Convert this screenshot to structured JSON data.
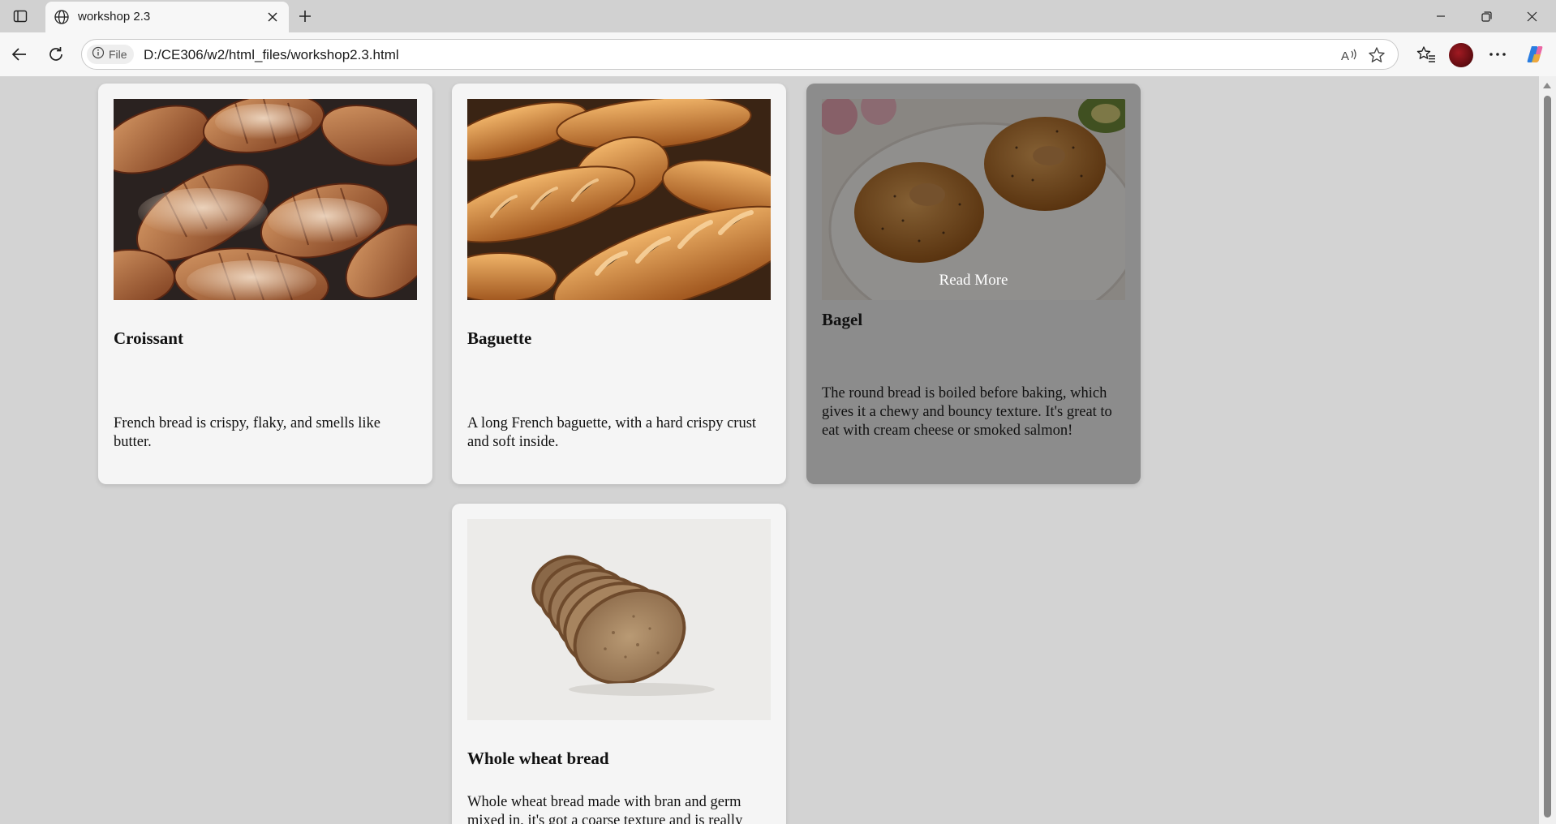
{
  "browser": {
    "tab_title": "workshop 2.3",
    "site_chip_label": "File",
    "url": "D:/CE306/w2/html_files/workshop2.3.html"
  },
  "icons": {
    "tab_actions": "tab-actions-icon",
    "favicon": "globe-icon",
    "close": "close-icon",
    "new_tab": "plus-icon",
    "minimize": "minimize-icon",
    "restore": "restore-icon",
    "window_close": "close-icon",
    "back": "back-arrow-icon",
    "refresh": "refresh-icon",
    "info": "info-icon",
    "read_aloud": "read-aloud-icon",
    "favorite": "star-icon",
    "favorites": "favorites-icon",
    "more": "more-icon",
    "copilot": "copilot-icon"
  },
  "cards": [
    {
      "title": "Croissant",
      "description": "French bread is crispy, flaky, and smells like butter.",
      "image": "croissant-photo"
    },
    {
      "title": "Baguette",
      "description": "A long French baguette, with a hard crispy crust and soft inside.",
      "image": "baguette-photo"
    },
    {
      "title": "Bagel",
      "description": "The round bread is boiled before baking, which gives it a chewy and bouncy texture. It's great to eat with cream cheese or smoked salmon!",
      "image": "bagel-photo",
      "hover_label": "Read More"
    },
    {
      "title": "Whole wheat bread",
      "description": "Whole wheat bread made with bran and germ mixed in, it's got a coarse texture and is really",
      "image": "whole-wheat-bread-photo"
    }
  ],
  "colors": {
    "page_background": "#d3d3d3",
    "card_background": "#f5f5f5",
    "hover_overlay": "#000000"
  }
}
